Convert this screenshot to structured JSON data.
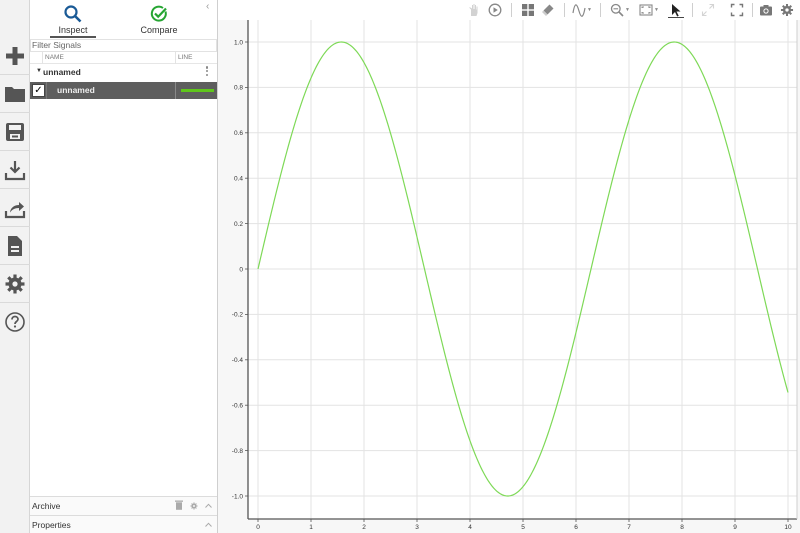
{
  "rail": {
    "items": [
      {
        "name": "new-icon",
        "label": "New"
      },
      {
        "name": "open-folder-icon",
        "label": "Open"
      },
      {
        "name": "save-icon",
        "label": "Save"
      },
      {
        "name": "import-icon",
        "label": "Import"
      },
      {
        "name": "export-icon",
        "label": "Export"
      },
      {
        "name": "report-icon",
        "label": "Report"
      },
      {
        "name": "settings-icon",
        "label": "Settings"
      },
      {
        "name": "help-icon",
        "label": "Help"
      }
    ]
  },
  "panel": {
    "tabs": [
      {
        "label": "Inspect",
        "active": true,
        "icon": "search-icon",
        "color": "#1a5a96"
      },
      {
        "label": "Compare",
        "active": false,
        "icon": "check-circle-icon",
        "color": "#26a532"
      }
    ],
    "collapse_glyph": "‹",
    "filter_placeholder": "Filter Signals",
    "columns": {
      "name": "NAME",
      "line": "LINE"
    },
    "group": {
      "name": "unnamed",
      "expanded": true
    },
    "signals": [
      {
        "name": "unnamed",
        "checked": true,
        "line_color": "#5fc61b"
      }
    ],
    "archive_label": "Archive",
    "properties_label": "Properties"
  },
  "toolbar": {
    "items": [
      "pan-hand-icon",
      "play-icon",
      "layout-grid-icon",
      "eraser-icon",
      "signal-style-icon",
      "zoom-icon",
      "fit-to-view-icon",
      "cursor-icon",
      "expand-icon",
      "fullscreen-icon",
      "camera-icon",
      "gear-icon"
    ],
    "active": "cursor-icon"
  },
  "chart_data": {
    "type": "line",
    "title": "",
    "xlabel": "",
    "ylabel": "",
    "xlim": [
      0,
      10
    ],
    "ylim": [
      -1.0,
      1.0
    ],
    "xticks": [
      "0",
      "1",
      "2",
      "3",
      "4",
      "5",
      "6",
      "7",
      "8",
      "9",
      "10"
    ],
    "yticks": [
      "1.0",
      "0.8",
      "0.6",
      "0.4",
      "0.2",
      "0",
      "-0.2",
      "-0.4",
      "-0.6",
      "-0.8",
      "-1.0"
    ],
    "grid": true,
    "series": [
      {
        "name": "unnamed",
        "color": "#7ed957",
        "function": "sin(x)",
        "x_range": [
          0,
          10
        ],
        "samples": [
          [
            0,
            0
          ],
          [
            1,
            0.841
          ],
          [
            1.571,
            1.0
          ],
          [
            2,
            0.909
          ],
          [
            3,
            0.141
          ],
          [
            4,
            -0.757
          ],
          [
            4.712,
            -1.0
          ],
          [
            5,
            -0.959
          ],
          [
            6,
            -0.279
          ],
          [
            7,
            0.657
          ],
          [
            7.854,
            1.0
          ],
          [
            8,
            0.989
          ],
          [
            9,
            0.412
          ],
          [
            10,
            -0.544
          ]
        ]
      }
    ]
  }
}
